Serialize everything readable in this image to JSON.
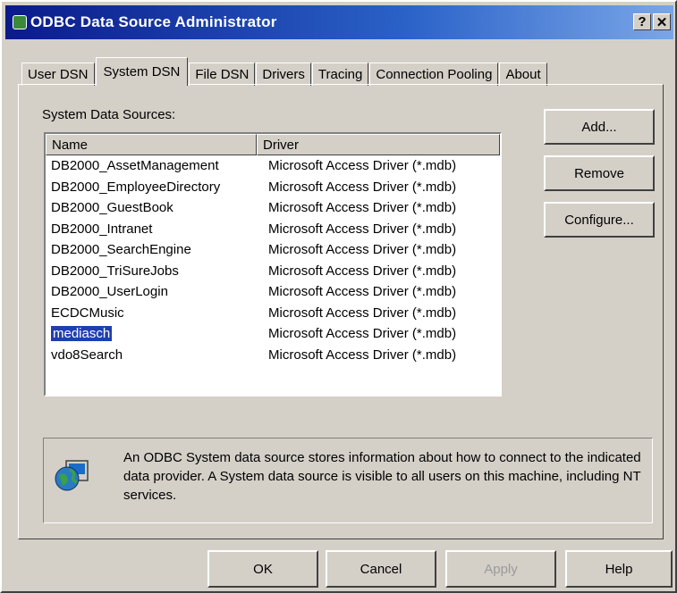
{
  "window": {
    "title": "ODBC Data Source Administrator",
    "help_button": "?",
    "close_button": "✕"
  },
  "tabs": [
    "User DSN",
    "System DSN",
    "File DSN",
    "Drivers",
    "Tracing",
    "Connection Pooling",
    "About"
  ],
  "active_tab": "System DSN",
  "section_label": "System Data Sources:",
  "list": {
    "headers": [
      "Name",
      "Driver"
    ],
    "rows": [
      [
        "DB2000_AssetManagement",
        "Microsoft Access Driver (*.mdb)"
      ],
      [
        "DB2000_EmployeeDirectory",
        "Microsoft Access Driver (*.mdb)"
      ],
      [
        "DB2000_GuestBook",
        "Microsoft Access Driver (*.mdb)"
      ],
      [
        "DB2000_Intranet",
        "Microsoft Access Driver (*.mdb)"
      ],
      [
        "DB2000_SearchEngine",
        "Microsoft Access Driver (*.mdb)"
      ],
      [
        "DB2000_TriSureJobs",
        "Microsoft Access Driver (*.mdb)"
      ],
      [
        "DB2000_UserLogin",
        "Microsoft Access Driver (*.mdb)"
      ],
      [
        "ECDCMusic",
        "Microsoft Access Driver (*.mdb)"
      ],
      [
        "mediasch",
        "Microsoft Access Driver (*.mdb)"
      ],
      [
        "vdo8Search",
        "Microsoft Access Driver (*.mdb)"
      ]
    ],
    "selected_row": 8
  },
  "side_buttons": {
    "add": "Add...",
    "remove": "Remove",
    "configure": "Configure..."
  },
  "description": "An ODBC System data source stores information about how to connect to the indicated data provider.  A System data source is visible to all users on this machine, including NT services.",
  "bottom_buttons": {
    "ok": "OK",
    "cancel": "Cancel",
    "apply": "Apply",
    "help": "Help"
  },
  "colors": {
    "title_bar": "#0a1a8a",
    "selection": "#1f3fb0",
    "face": "#d4d0c8"
  }
}
